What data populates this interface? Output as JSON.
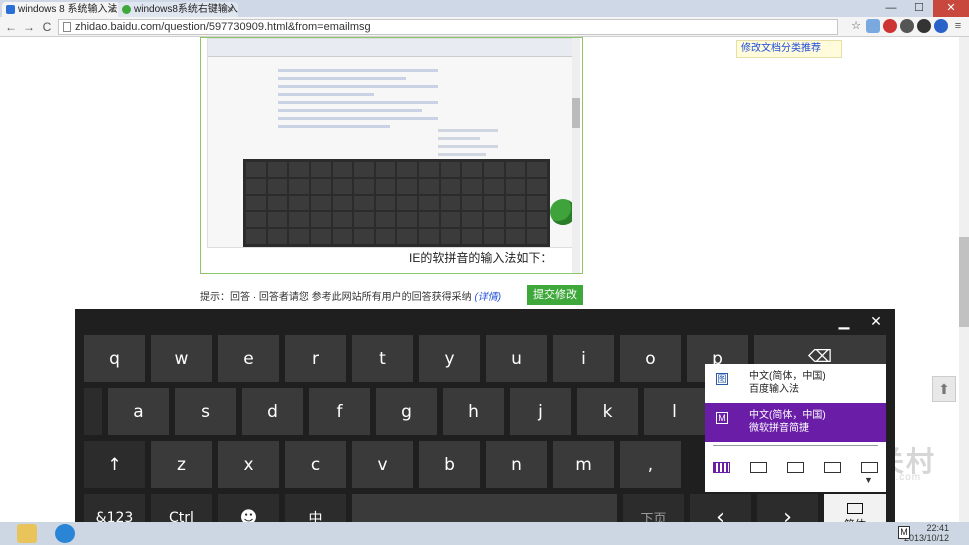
{
  "browser": {
    "tabs": [
      {
        "title": "windows 8 系统输入法",
        "active": true
      },
      {
        "title": "windows8系统右键输入法",
        "active": false
      }
    ],
    "url": "zhidao.baidu.com/question/597730909.html&from=emailmsg",
    "window_controls": {
      "minimize": "—",
      "maximize": "☐",
      "close": "✕"
    },
    "nav": {
      "back": "←",
      "forward": "→",
      "reload": "C"
    }
  },
  "page": {
    "caption": "IE的软拼音的输入法如下：",
    "hint_text": "提示：回答 · 回答者请您 参考此网站所有用户的回答获得采纳",
    "hint_link": "(详情)",
    "submit_label": "提交修改",
    "side_link": "修改文档分类推荐",
    "to_top": "⬆",
    "watermark": "中关村",
    "watermark_sub": "baidu.com"
  },
  "keyboard": {
    "rows": [
      [
        "q",
        "w",
        "e",
        "r",
        "t",
        "y",
        "u",
        "i",
        "o",
        "p",
        "⌫"
      ],
      [
        "a",
        "s",
        "d",
        "f",
        "g",
        "h",
        "j",
        "k",
        "l"
      ],
      [
        "↑",
        "z",
        "x",
        "c",
        "v",
        "b",
        "n",
        "m",
        ","
      ],
      [
        "&123",
        "Ctrl",
        "☻",
        "中",
        "",
        "下页",
        "‹",
        "›",
        "简体"
      ]
    ],
    "minimize_icon": "▁",
    "close_icon": "✕"
  },
  "ime_popup": {
    "items": [
      {
        "line1": "中文(简体，中国)",
        "line2": "百度输入法",
        "icon": "图"
      },
      {
        "line1": "中文(简体，中国)",
        "line2": "微软拼音简捷",
        "icon": "M"
      }
    ],
    "selected_index": 1,
    "layout_options": 5,
    "active_layout": 0
  },
  "taskbar": {
    "time": "22:41",
    "date": "2013/10/12",
    "ime_indicator": "M"
  },
  "colors": {
    "keyboard_bg": "#1f1f1f",
    "key_bg": "#3a3a3a",
    "accent_purple": "#6a1ea8",
    "submit_green": "#3ea83a",
    "frame_green": "#8cc56a"
  }
}
